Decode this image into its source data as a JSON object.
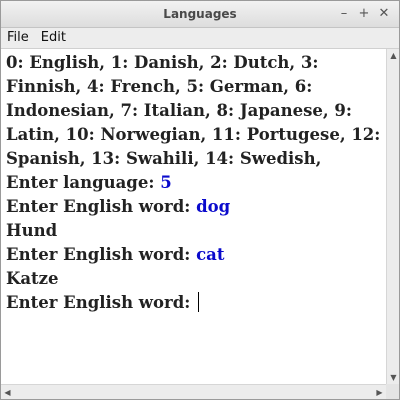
{
  "window": {
    "title": "Languages",
    "minimize_glyph": "–",
    "maximize_glyph": "+",
    "close_glyph": "✕"
  },
  "menu": {
    "file_label": "File",
    "edit_label": "Edit"
  },
  "console": {
    "language_list": "0: English, 1: Danish, 2: Dutch, 3: Finnish, 4: French, 5: German, 6: Indonesian, 7: Italian, 8: Japanese, 9: Latin, 10: Norwegian, 11: Portugese, 12: Spanish, 13: Swahili, 14: Swedish,",
    "prompt_language": "Enter language: ",
    "input_language": "5",
    "prompt_word_1": "Enter English word: ",
    "input_word_1": "dog",
    "output_1": "Hund",
    "prompt_word_2": "Enter English word: ",
    "input_word_2": "cat",
    "output_2": "Katze",
    "prompt_word_3": "Enter English word: "
  },
  "colors": {
    "input_text": "#0a0acc",
    "output_text": "#222222"
  },
  "scrollbars": {
    "up_arrow": "▲",
    "down_arrow": "▼",
    "left_arrow": "◀",
    "right_arrow": "▶"
  }
}
